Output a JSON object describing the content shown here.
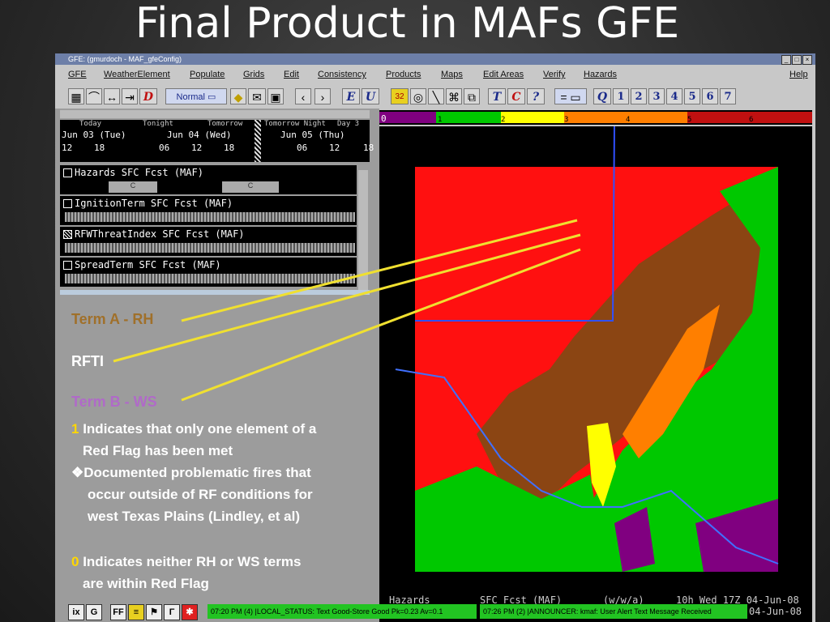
{
  "slide": {
    "title": "Final Product in MAFs GFE"
  },
  "window": {
    "title": "GFE: (gmurdoch - MAF_gfeConfig)"
  },
  "menu": [
    "GFE",
    "WeatherElement",
    "Populate",
    "Grids",
    "Edit",
    "Consistency",
    "Products",
    "Maps",
    "Edit Areas",
    "Verify",
    "Hazards",
    "Help"
  ],
  "toolbar": {
    "mode": "Normal",
    "buttons": [
      "D",
      "E",
      "U",
      "T",
      "C",
      "?",
      "Q"
    ],
    "numbers": [
      "1",
      "2",
      "3",
      "4",
      "5",
      "6",
      "7"
    ],
    "icon32": "32"
  },
  "timescale": {
    "periods": [
      "Today",
      "Tonight",
      "Tomorrow",
      "Tomorrow Night",
      "Day 3"
    ],
    "dates": [
      "Jun 03 (Tue)",
      "Jun 04 (Wed)",
      "Jun 05 (Thu)"
    ],
    "hours": [
      "12",
      "18",
      "06",
      "12",
      "18",
      "06",
      "12",
      "18"
    ]
  },
  "grids": [
    {
      "label": "Hazards SFC  Fcst (MAF)",
      "block": "C"
    },
    {
      "label": "IgnitionTerm SFC  Fcst (MAF)",
      "block": ""
    },
    {
      "label": "RFWThreatIndex SFC  Fcst (MAF)",
      "block": ""
    },
    {
      "label": "SpreadTerm SFC  Fcst (MAF)",
      "block": ""
    }
  ],
  "legend": {
    "ticks": [
      "0",
      "1",
      "2",
      "3",
      "4",
      "5",
      "6"
    ],
    "colors": [
      "#800080",
      "#00c800",
      "#ffff00",
      "#ff7f00",
      "#8b4513",
      "#c0301a",
      "#ff0000"
    ]
  },
  "notes": {
    "term_a": "Term A - RH",
    "rfti": "RFTI",
    "term_b": "Term B - WS",
    "one_num": "1",
    "one_text": "Indicates that only one element of a",
    "one_text2": "Red Flag has been met",
    "bullet": "Documented problematic fires that",
    "bullet2": "occur outside of RF conditions for",
    "bullet3": "west Texas Plains  (Lindley, et al)",
    "zero_num": "0",
    "zero_text": "Indicates neither RH or WS terms",
    "zero_text2": "are within Red Flag"
  },
  "map_footer": {
    "left": "Hazards",
    "mid": "SFC Fcst (MAF)",
    "wwa": "(w/w/a)",
    "time": "10h Wed 17Z 04-Jun-08",
    "date2": "04-Jun-08"
  },
  "taskbar": {
    "status1": "07:20 PM (4) |LOCAL_STATUS: Text Good-Store Good Pk=0.23 Av=0.1",
    "status2": "07:26 PM (2) |ANNOUNCER: kmaf: User Alert Text Message Received",
    "ff": "FF"
  },
  "colors": {
    "term_a": "#a0702a",
    "rfti": "#ffffff",
    "term_b": "#b06ac8",
    "highlight": "#ffd700"
  }
}
